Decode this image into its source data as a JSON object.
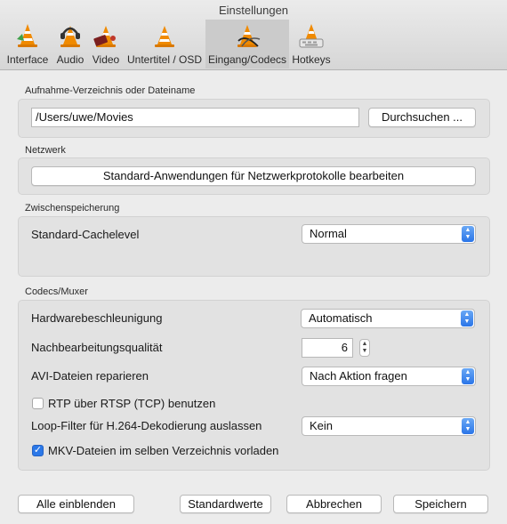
{
  "window": {
    "title": "Einstellungen"
  },
  "tabs": [
    {
      "label": "Interface",
      "icon": "vlc-cone-icon"
    },
    {
      "label": "Audio",
      "icon": "headphones-cone-icon"
    },
    {
      "label": "Video",
      "icon": "film-cone-icon"
    },
    {
      "label": "Untertitel / OSD",
      "icon": "subtitle-cone-icon"
    },
    {
      "label": "Eingang/Codecs",
      "icon": "cable-cone-icon",
      "active": true
    },
    {
      "label": "Hotkeys",
      "icon": "keyboard-cone-icon"
    }
  ],
  "recording": {
    "section_title": "Aufnahme-Verzeichnis oder Dateiname",
    "path_value": "/Users/uwe/Movies",
    "browse_label": "Durchsuchen ..."
  },
  "network": {
    "section_title": "Netzwerk",
    "edit_protocols_label": "Standard-Anwendungen für Netzwerkprotokolle bearbeiten"
  },
  "caching": {
    "section_title": "Zwischenspeicherung",
    "cache_level_label": "Standard-Cachelevel",
    "cache_level_value": "Normal"
  },
  "codecs": {
    "section_title": "Codecs/Muxer",
    "hw_accel_label": "Hardwarebeschleunigung",
    "hw_accel_value": "Automatisch",
    "postproc_label": "Nachbearbeitungsqualität",
    "postproc_value": "6",
    "avi_repair_label": "AVI-Dateien reparieren",
    "avi_repair_value": "Nach Aktion fragen",
    "rtp_label": "RTP über RTSP (TCP) benutzen",
    "rtp_checked": false,
    "loop_filter_label": "Loop-Filter für H.264-Dekodierung auslassen",
    "loop_filter_value": "Kein",
    "mkv_label": "MKV-Dateien im selben Verzeichnis vorladen",
    "mkv_checked": true
  },
  "footer": {
    "show_all_label": "Alle einblenden",
    "defaults_label": "Standardwerte",
    "cancel_label": "Abbrechen",
    "save_label": "Speichern"
  },
  "colors": {
    "accent": "#2b78e8",
    "cone_orange": "#f08a00"
  }
}
